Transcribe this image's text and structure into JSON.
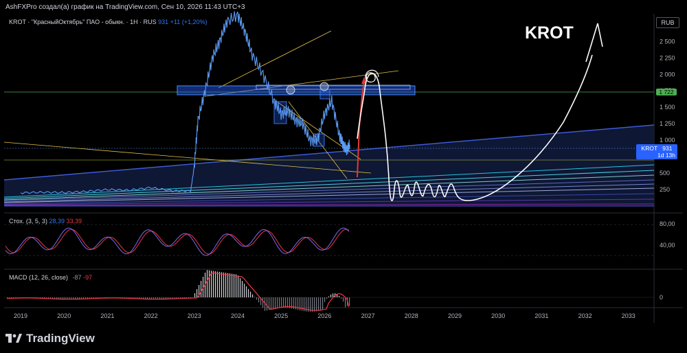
{
  "header": {
    "title": "AshFXPro создал(а) график на TradingView.com, Сен 10, 2026 11:43 UTC+3"
  },
  "symbol": {
    "label": "KROT · \"КрасныйОктябрь\" ПАО - обыкн. · 1H · RUS",
    "price": "931",
    "change": "+11 (+1,20%)"
  },
  "currency": "RUB",
  "annotation": "KROT",
  "price_labels": {
    "level": "1 722",
    "ticker": "KROT",
    "last": "931",
    "countdown": "1d 13h"
  },
  "indicators": {
    "stoch": {
      "name": "Стох. (3, 5, 3)",
      "k": "28,39",
      "d": "33,39",
      "k_color": "#3179f5",
      "d_color": "#f23645"
    },
    "macd": {
      "name": "MACD (12, 26, close)",
      "macd": "-87",
      "signal": "-97",
      "macd_color": "#9598a1",
      "signal_color": "#f23645"
    }
  },
  "brand": {
    "name": "TradingView"
  },
  "colors": {
    "price_line": "#5b9cf6",
    "hand_drawn": "#ffffff",
    "zone": "#2962ff",
    "level_line": "#4caf50"
  },
  "chart_data": [
    {
      "type": "line",
      "title": "",
      "series": [
        {
          "x": [
            "2019-01",
            "2019-07",
            "2020-01",
            "2020-07",
            "2021-01",
            "2021-07",
            "2022-01",
            "2022-07",
            "2022-12",
            "2023-01",
            "2023-02",
            "2023-04",
            "2023-06",
            "2023-08",
            "2023-10",
            "2024-01",
            "2024-03",
            "2024-05",
            "2024-08",
            "2024-11",
            "2025-01",
            "2025-03",
            "2025-05",
            "2025-07",
            "2025-09",
            "2025-11",
            "2026-01",
            "2026-03",
            "2026-05",
            "2026-06",
            "2026-07",
            "2026-08"
          ],
          "y": [
            200,
            210,
            205,
            220,
            250,
            240,
            280,
            230,
            230,
            600,
            1300,
            1750,
            2250,
            2500,
            2800,
            2900,
            2650,
            2300,
            2000,
            1600,
            1400,
            1450,
            1300,
            1250,
            1000,
            1000,
            1400,
            1600,
            1100,
            950,
            850,
            931
          ]
        }
      ],
      "ylim": [
        0,
        2900
      ],
      "y_ticks": [
        "2 500",
        "2 250",
        "2 000",
        "1 750",
        "1 500",
        "1 250",
        "1 000",
        "750",
        "500",
        "250"
      ],
      "x_ticks": [
        "2019",
        "2020",
        "2021",
        "2022",
        "2023",
        "2024",
        "2025",
        "2026",
        "2027",
        "2028",
        "2029",
        "2030",
        "2031",
        "2032",
        "2033"
      ],
      "levels": [
        1722,
        750
      ],
      "grid": false
    },
    {
      "type": "line",
      "title": "Стох. (3, 5, 3)",
      "series": [
        {
          "name": "%K",
          "last": 28.39
        },
        {
          "name": "%D",
          "last": 33.39
        }
      ],
      "y_ticks": [
        "80,00",
        "40,00"
      ]
    },
    {
      "type": "bar",
      "title": "MACD (12, 26, close)",
      "series": [
        {
          "name": "MACD",
          "last": -87
        },
        {
          "name": "Signal",
          "last": -97
        }
      ],
      "y_ticks": [
        "0"
      ]
    }
  ]
}
